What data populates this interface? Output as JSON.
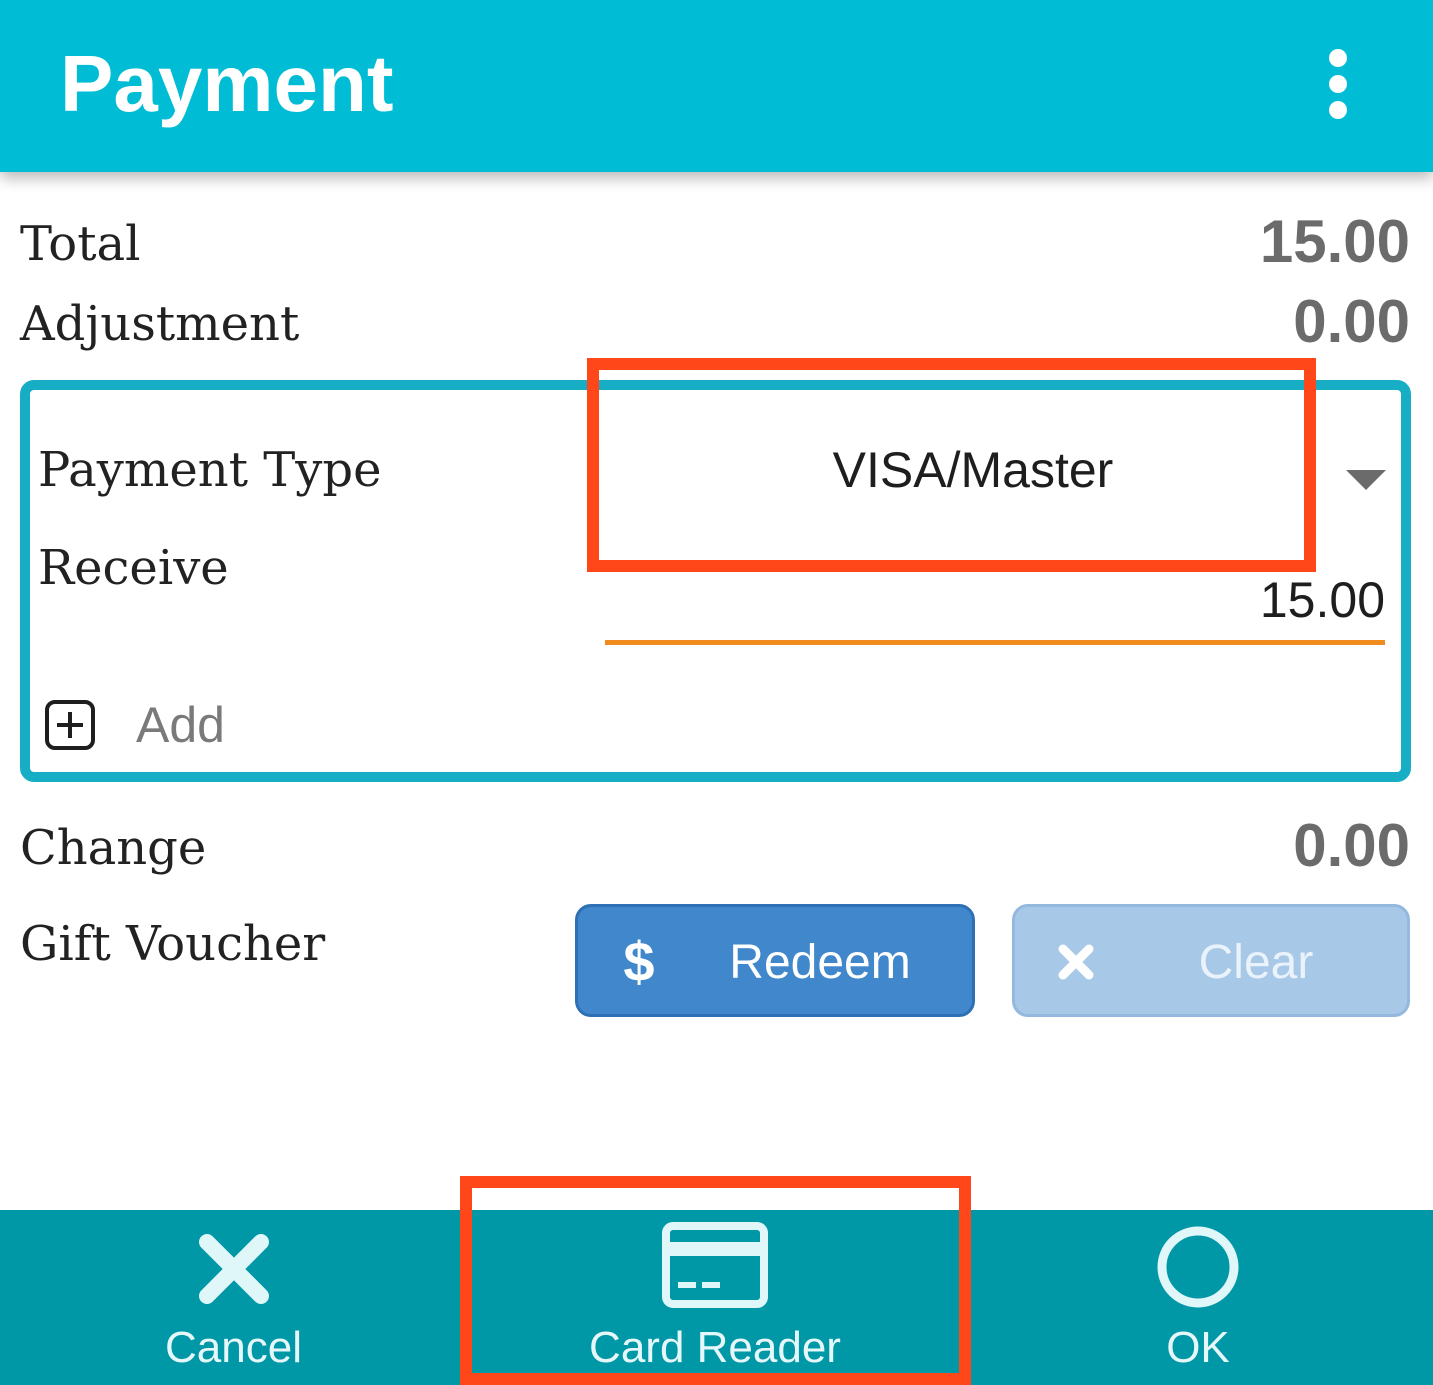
{
  "app_bar": {
    "title": "Payment",
    "menu_icon": "more-vert-icon"
  },
  "summary": {
    "total_label": "Total",
    "total_value": "15.00",
    "adjustment_label": "Adjustment",
    "adjustment_value": "0.00"
  },
  "payment": {
    "type_label": "Payment Type",
    "type_value": "VISA/Master",
    "receive_label": "Receive",
    "receive_value": "15.00",
    "add_label": "Add",
    "add_icon": "add-box-icon"
  },
  "change": {
    "label": "Change",
    "value": "0.00"
  },
  "gift_voucher": {
    "label": "Gift Voucher",
    "redeem_label": "Redeem",
    "redeem_icon": "dollar-icon",
    "clear_label": "Clear",
    "clear_icon": "close-icon"
  },
  "bottom_bar": {
    "cancel_label": "Cancel",
    "cancel_icon": "close-icon",
    "card_reader_label": "Card Reader",
    "card_reader_icon": "credit-card-icon",
    "ok_label": "OK",
    "ok_icon": "circle-icon"
  },
  "colors": {
    "app_bar": "#00bcd4",
    "card_border": "#17aec5",
    "receive_underline": "#f08c1e",
    "redeem_button": "#4187cb",
    "clear_button": "#a8c8e8",
    "bottom_bar": "#0097a7",
    "highlight": "#ff4719"
  }
}
